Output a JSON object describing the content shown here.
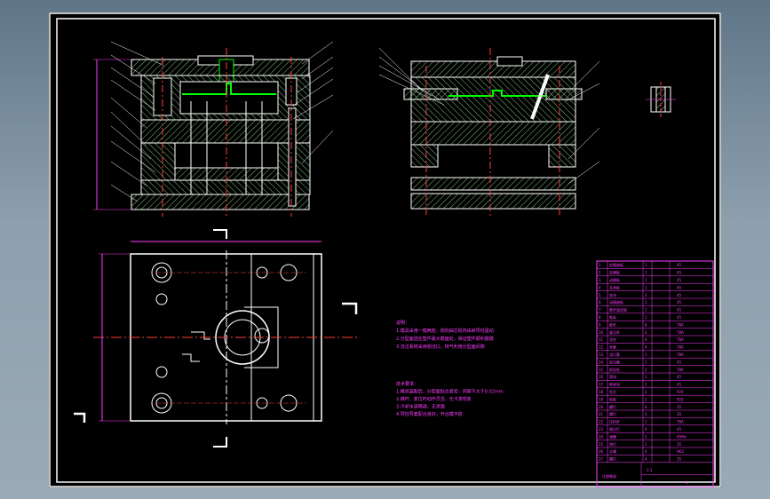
{
  "colors": {
    "background": "#000000",
    "border": "#ffffff",
    "section": "#ffffff",
    "hatch": "#7fbf7f",
    "cavity": "#00ff00",
    "centerline": "#ff3c3c",
    "dimension": "#ff3cff",
    "window": "#7f94a4"
  },
  "notes": {
    "block1": [
      "说明：",
      "1.模具采用一模两腔，侧向抽芯机构由斜导柱驱动",
      "2.分型面选在塑件最大截面处，保证塑件顺利脱模",
      "3.浇注系统采用侧浇口，排气利用分型面间隙"
    ],
    "block2": [
      "技术要求：",
      "1.模具装配后，分型面贴合紧密，间隙不大于0.02mm",
      "2.推杆、复位杆动作灵活，无卡滞现象",
      "3.冷却水道畅通，无渗漏",
      "4.导柱导套配合良好，开合模平稳"
    ]
  },
  "title_block": {
    "rows": [
      [
        "1",
        "定模座板",
        "1",
        "45"
      ],
      [
        "2",
        "定模板",
        "1",
        "45"
      ],
      [
        "3",
        "动模板",
        "1",
        "45"
      ],
      [
        "4",
        "支承板",
        "1",
        "45"
      ],
      [
        "5",
        "垫块",
        "2",
        "45"
      ],
      [
        "6",
        "动模座板",
        "1",
        "45"
      ],
      [
        "7",
        "推杆固定板",
        "1",
        "45"
      ],
      [
        "8",
        "推板",
        "1",
        "45"
      ],
      [
        "9",
        "推杆",
        "8",
        "T8A"
      ],
      [
        "10",
        "复位杆",
        "4",
        "T8A"
      ],
      [
        "11",
        "导柱",
        "4",
        "T8A"
      ],
      [
        "12",
        "导套",
        "4",
        "T8A"
      ],
      [
        "13",
        "浇口套",
        "1",
        "T8A"
      ],
      [
        "14",
        "定位圈",
        "1",
        "45"
      ],
      [
        "15",
        "斜导柱",
        "2",
        "T8A"
      ],
      [
        "16",
        "滑块",
        "2",
        "45"
      ],
      [
        "17",
        "楔紧块",
        "2",
        "45"
      ],
      [
        "18",
        "型芯",
        "2",
        "P20"
      ],
      [
        "19",
        "型腔",
        "2",
        "P20"
      ],
      [
        "20",
        "螺钉",
        "6",
        "35"
      ],
      [
        "21",
        "螺钉",
        "4",
        "35"
      ],
      [
        "22",
        "拉料杆",
        "1",
        "T8A"
      ],
      [
        "23",
        "限位钉",
        "4",
        "45"
      ],
      [
        "24",
        "弹簧",
        "2",
        "65Mn"
      ],
      [
        "25",
        "销钉",
        "2",
        "35"
      ],
      [
        "26",
        "水嘴",
        "4",
        "H62"
      ],
      [
        "27",
        "螺钉",
        "4",
        "35"
      ]
    ],
    "footer": {
      "title": "注塑模具",
      "scale": "1:1",
      "sheet": "1"
    }
  }
}
